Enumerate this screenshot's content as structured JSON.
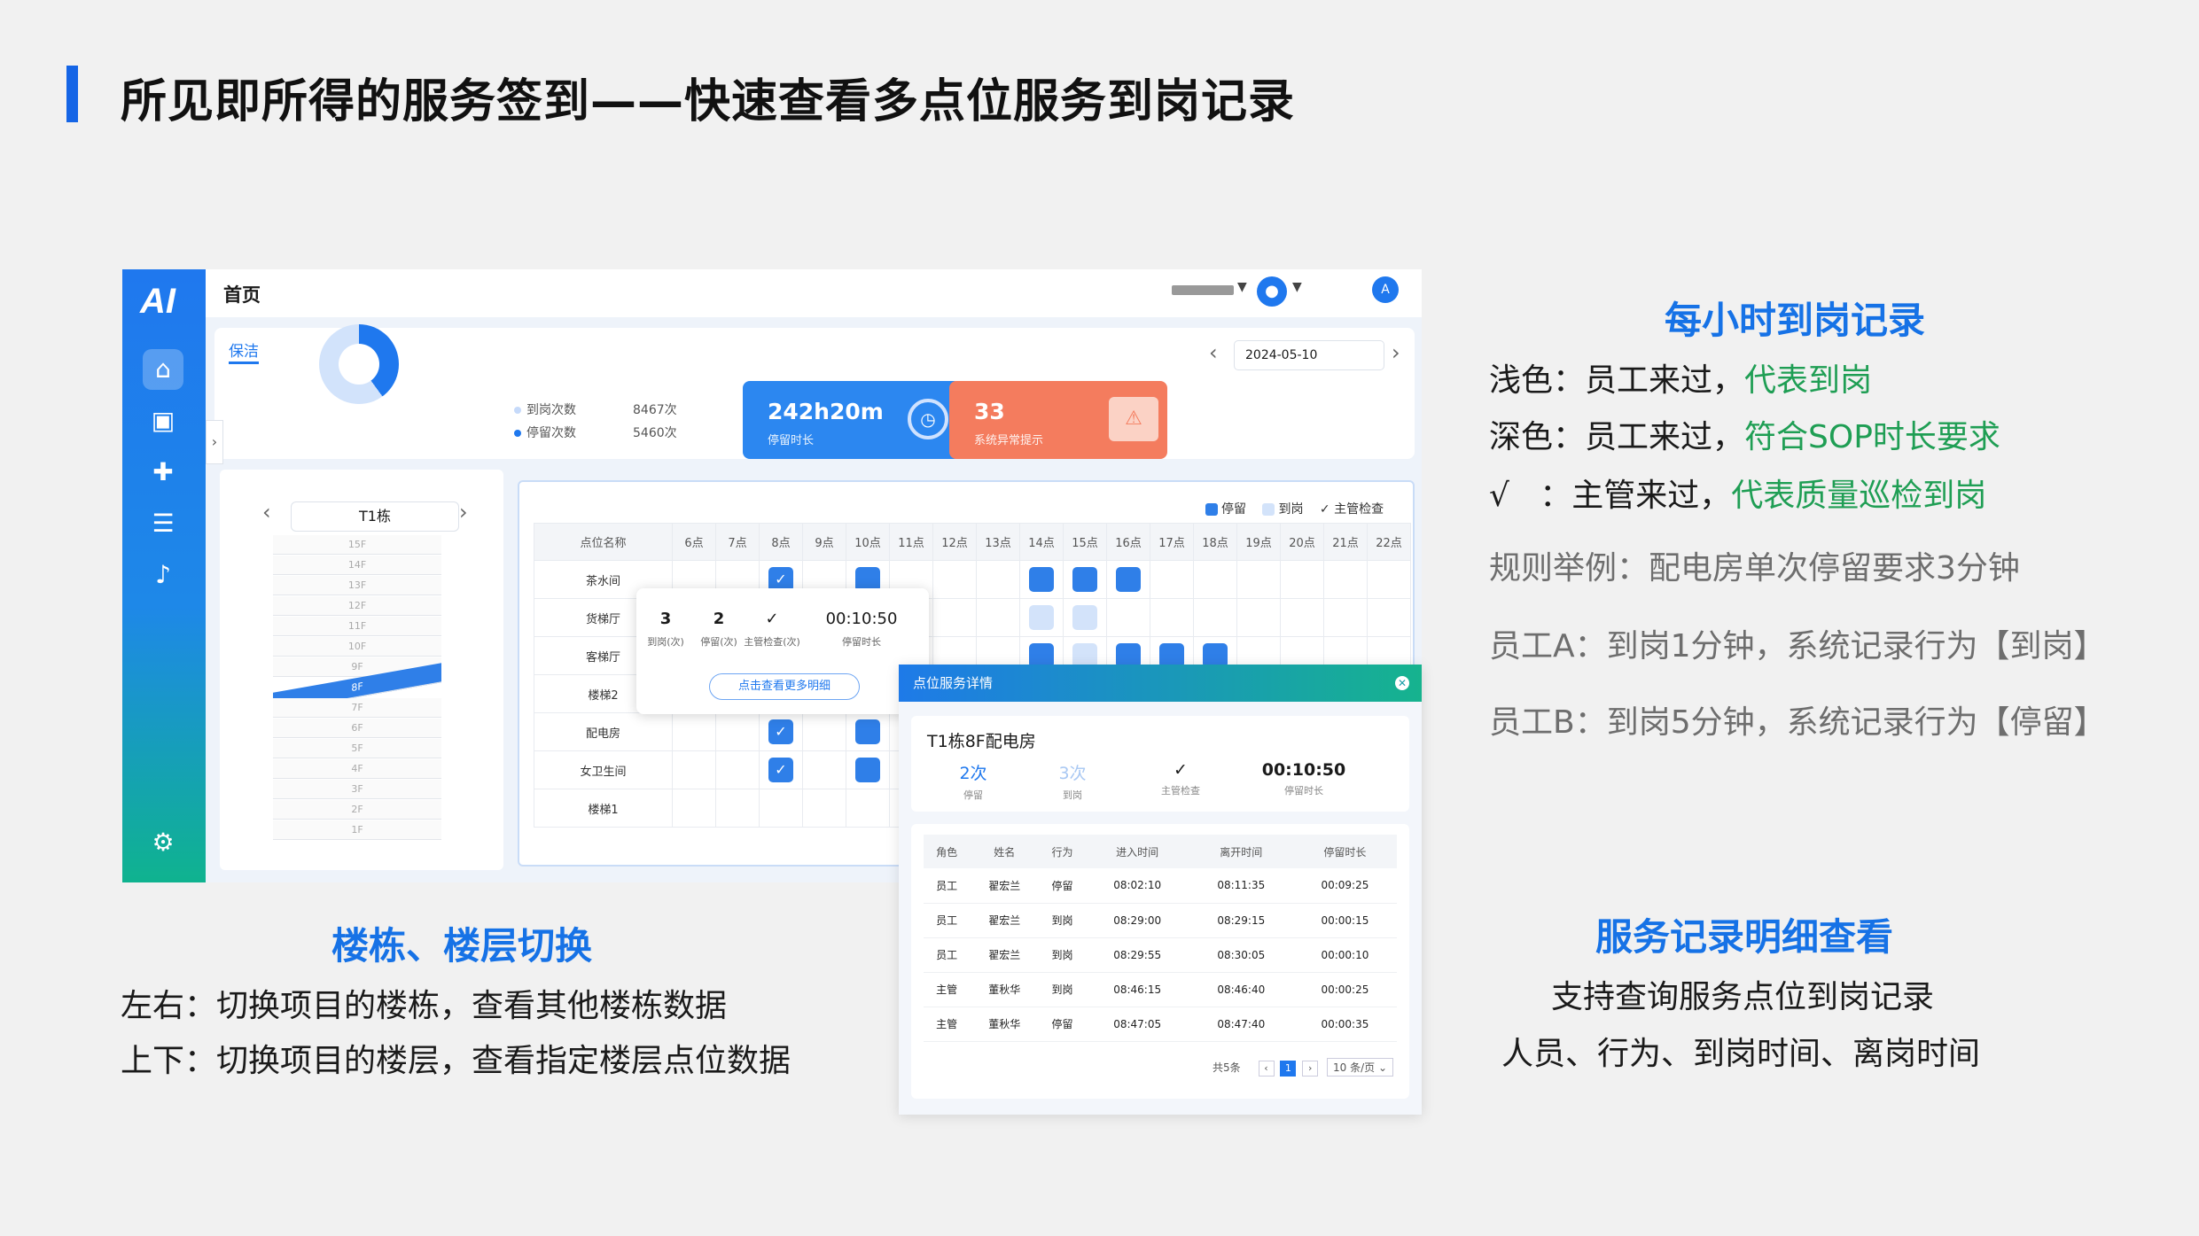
{
  "slide": {
    "title": "所见即所得的服务签到——快速查看多点位服务到岗记录"
  },
  "app": {
    "logo": "AI",
    "breadcrumb": "首页",
    "tab": "保洁",
    "date": "2024-05-10",
    "stats": {
      "arrive_label": "到岗次数",
      "arrive_value": "8467次",
      "stay_label": "停留次数",
      "stay_value": "5460次"
    },
    "card_duration": {
      "value": "242h20m",
      "label": "停留时长"
    },
    "card_alert": {
      "value": "33",
      "label": "系统异常提示"
    },
    "building": "T1栋",
    "floors": [
      "15F",
      "14F",
      "13F",
      "12F",
      "11F",
      "10F",
      "9F",
      "8F",
      "7F",
      "6F",
      "5F",
      "4F",
      "3F",
      "2F",
      "1F"
    ],
    "selected_floor": "8F",
    "grid_legend": [
      "停留",
      "到岗",
      "主管检查"
    ],
    "grid_header": [
      "点位名称",
      "6点",
      "7点",
      "8点",
      "9点",
      "10点",
      "11点",
      "12点",
      "13点",
      "14点",
      "15点",
      "16点",
      "17点",
      "18点",
      "19点",
      "20点",
      "21点",
      "22点"
    ],
    "grid_rows": [
      "茶水间",
      "货梯厅",
      "客梯厅",
      "楼梯2",
      "配电房",
      "女卫生间",
      "楼梯1"
    ],
    "popup": {
      "stay": "3",
      "stay_label": "到岗(次)",
      "arrive": "2",
      "arrive_label": "停留(次)",
      "check_label": "主管检查(次)",
      "duration": "00:10:50",
      "duration_label": "停留时长",
      "button": "点击查看更多明细"
    },
    "detail": {
      "header": "点位服务详情",
      "location": "T1栋8F配电房",
      "stats": [
        {
          "v": "2次",
          "l": "停留"
        },
        {
          "v": "3次",
          "l": "到岗"
        },
        {
          "v": "✓",
          "l": "主管检查"
        },
        {
          "v": "00:10:50",
          "l": "停留时长"
        }
      ],
      "columns": [
        "角色",
        "姓名",
        "行为",
        "进入时间",
        "离开时间",
        "停留时长"
      ],
      "rows": [
        [
          "员工",
          "翟宏兰",
          "停留",
          "08:02:10",
          "08:11:35",
          "00:09:25"
        ],
        [
          "员工",
          "翟宏兰",
          "到岗",
          "08:29:00",
          "08:29:15",
          "00:00:15"
        ],
        [
          "员工",
          "翟宏兰",
          "到岗",
          "08:29:55",
          "08:30:05",
          "00:00:10"
        ],
        [
          "主管",
          "董秋华",
          "到岗",
          "08:46:15",
          "08:46:40",
          "00:00:25"
        ],
        [
          "主管",
          "董秋华",
          "停留",
          "08:47:05",
          "08:47:40",
          "00:00:35"
        ]
      ],
      "total": "共5条",
      "page": "1",
      "page_size": "10 条/页"
    }
  },
  "annotations": {
    "hourly_title": "每小时到岗记录",
    "light": {
      "prefix": "浅色：员工来过，",
      "hl": "代表到岗"
    },
    "dark": {
      "prefix": "深色：员工来过，",
      "hl": "符合SOP时长要求"
    },
    "check": {
      "prefix": "√   ：主管来过，",
      "hl": "代表质量巡检到岗"
    },
    "rule": "规则举例：配电房单次停留要求3分钟",
    "empA": "员工A：到岗1分钟，系统记录行为【到岗】",
    "empB": "员工B：到岗5分钟，系统记录行为【停留】",
    "switch_title": "楼栋、楼层切换",
    "switch_lr": "左右：切换项目的楼栋，查看其他楼栋数据",
    "switch_ud": "上下：切换项目的楼层，查看指定楼层点位数据",
    "detail_title": "服务记录明细查看",
    "detail_line1": "支持查询服务点位到岗记录",
    "detail_line2": "人员、行为、到岗时间、离岗时间"
  },
  "colors": {
    "accent": "#1672e6",
    "highlight": "#1f9e54",
    "card_blue": "#2c87f0",
    "card_red": "#f47c5e"
  }
}
